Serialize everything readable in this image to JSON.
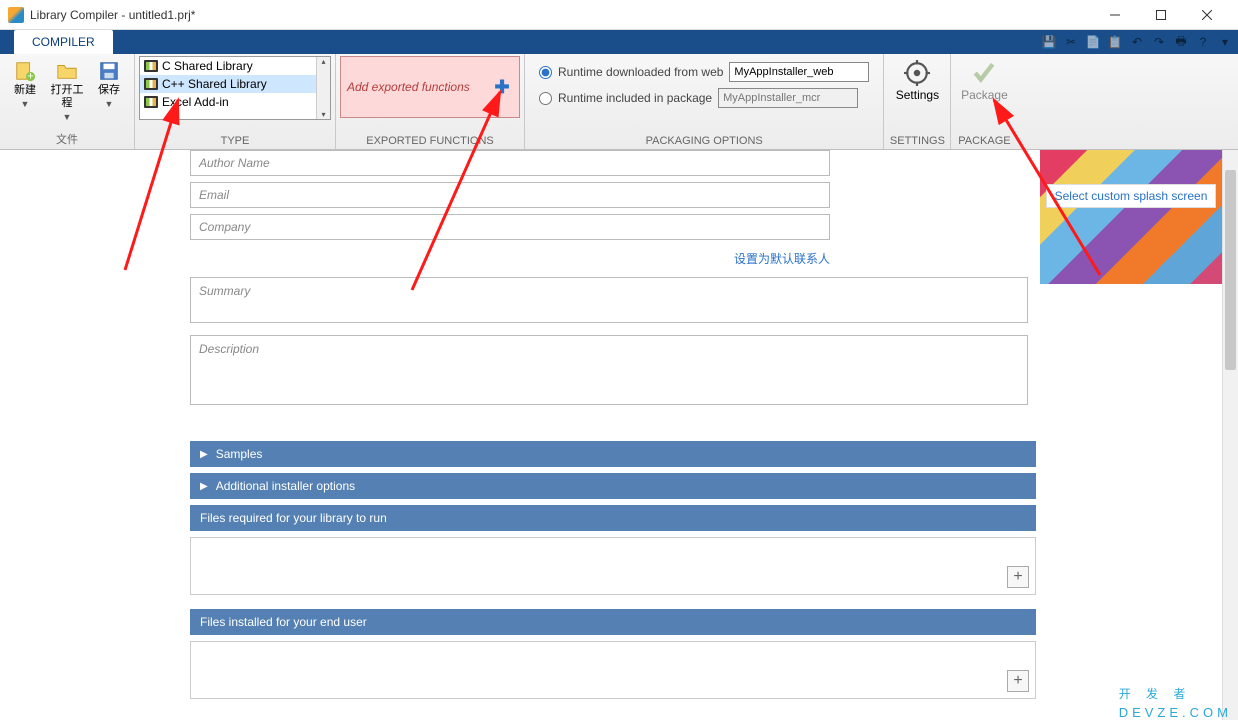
{
  "window": {
    "title": "Library Compiler - untitled1.prj*"
  },
  "tab": {
    "compiler": "COMPILER"
  },
  "ribbon": {
    "file": {
      "new": "新建",
      "open": "打开工程",
      "save": "保存",
      "label": "文件"
    },
    "type": {
      "label": "TYPE",
      "items": [
        "C Shared Library",
        "C++ Shared Library",
        "Excel Add-in"
      ]
    },
    "exported": {
      "label": "EXPORTED FUNCTIONS",
      "placeholder": "Add exported functions"
    },
    "packaging": {
      "label": "PACKAGING OPTIONS",
      "opt1": "Runtime downloaded from web",
      "opt2": "Runtime included in package",
      "val1": "MyAppInstaller_web",
      "val2": "MyAppInstaller_mcr"
    },
    "settings": {
      "label": "SETTINGS",
      "btn": "Settings"
    },
    "package": {
      "label": "PACKAGE",
      "btn": "Package"
    }
  },
  "form": {
    "author": "Author Name",
    "email": "Email",
    "company": "Company",
    "defaultContact": "设置为默认联系人",
    "summary": "Summary",
    "description": "Description",
    "splash": "Select custom splash screen"
  },
  "sections": {
    "samples": "Samples",
    "addl": "Additional installer options",
    "required": "Files required for your library to run",
    "installed": "Files installed for your end user"
  },
  "watermark": {
    "big": "开 发 者",
    "small": "DEVZE.COM"
  }
}
